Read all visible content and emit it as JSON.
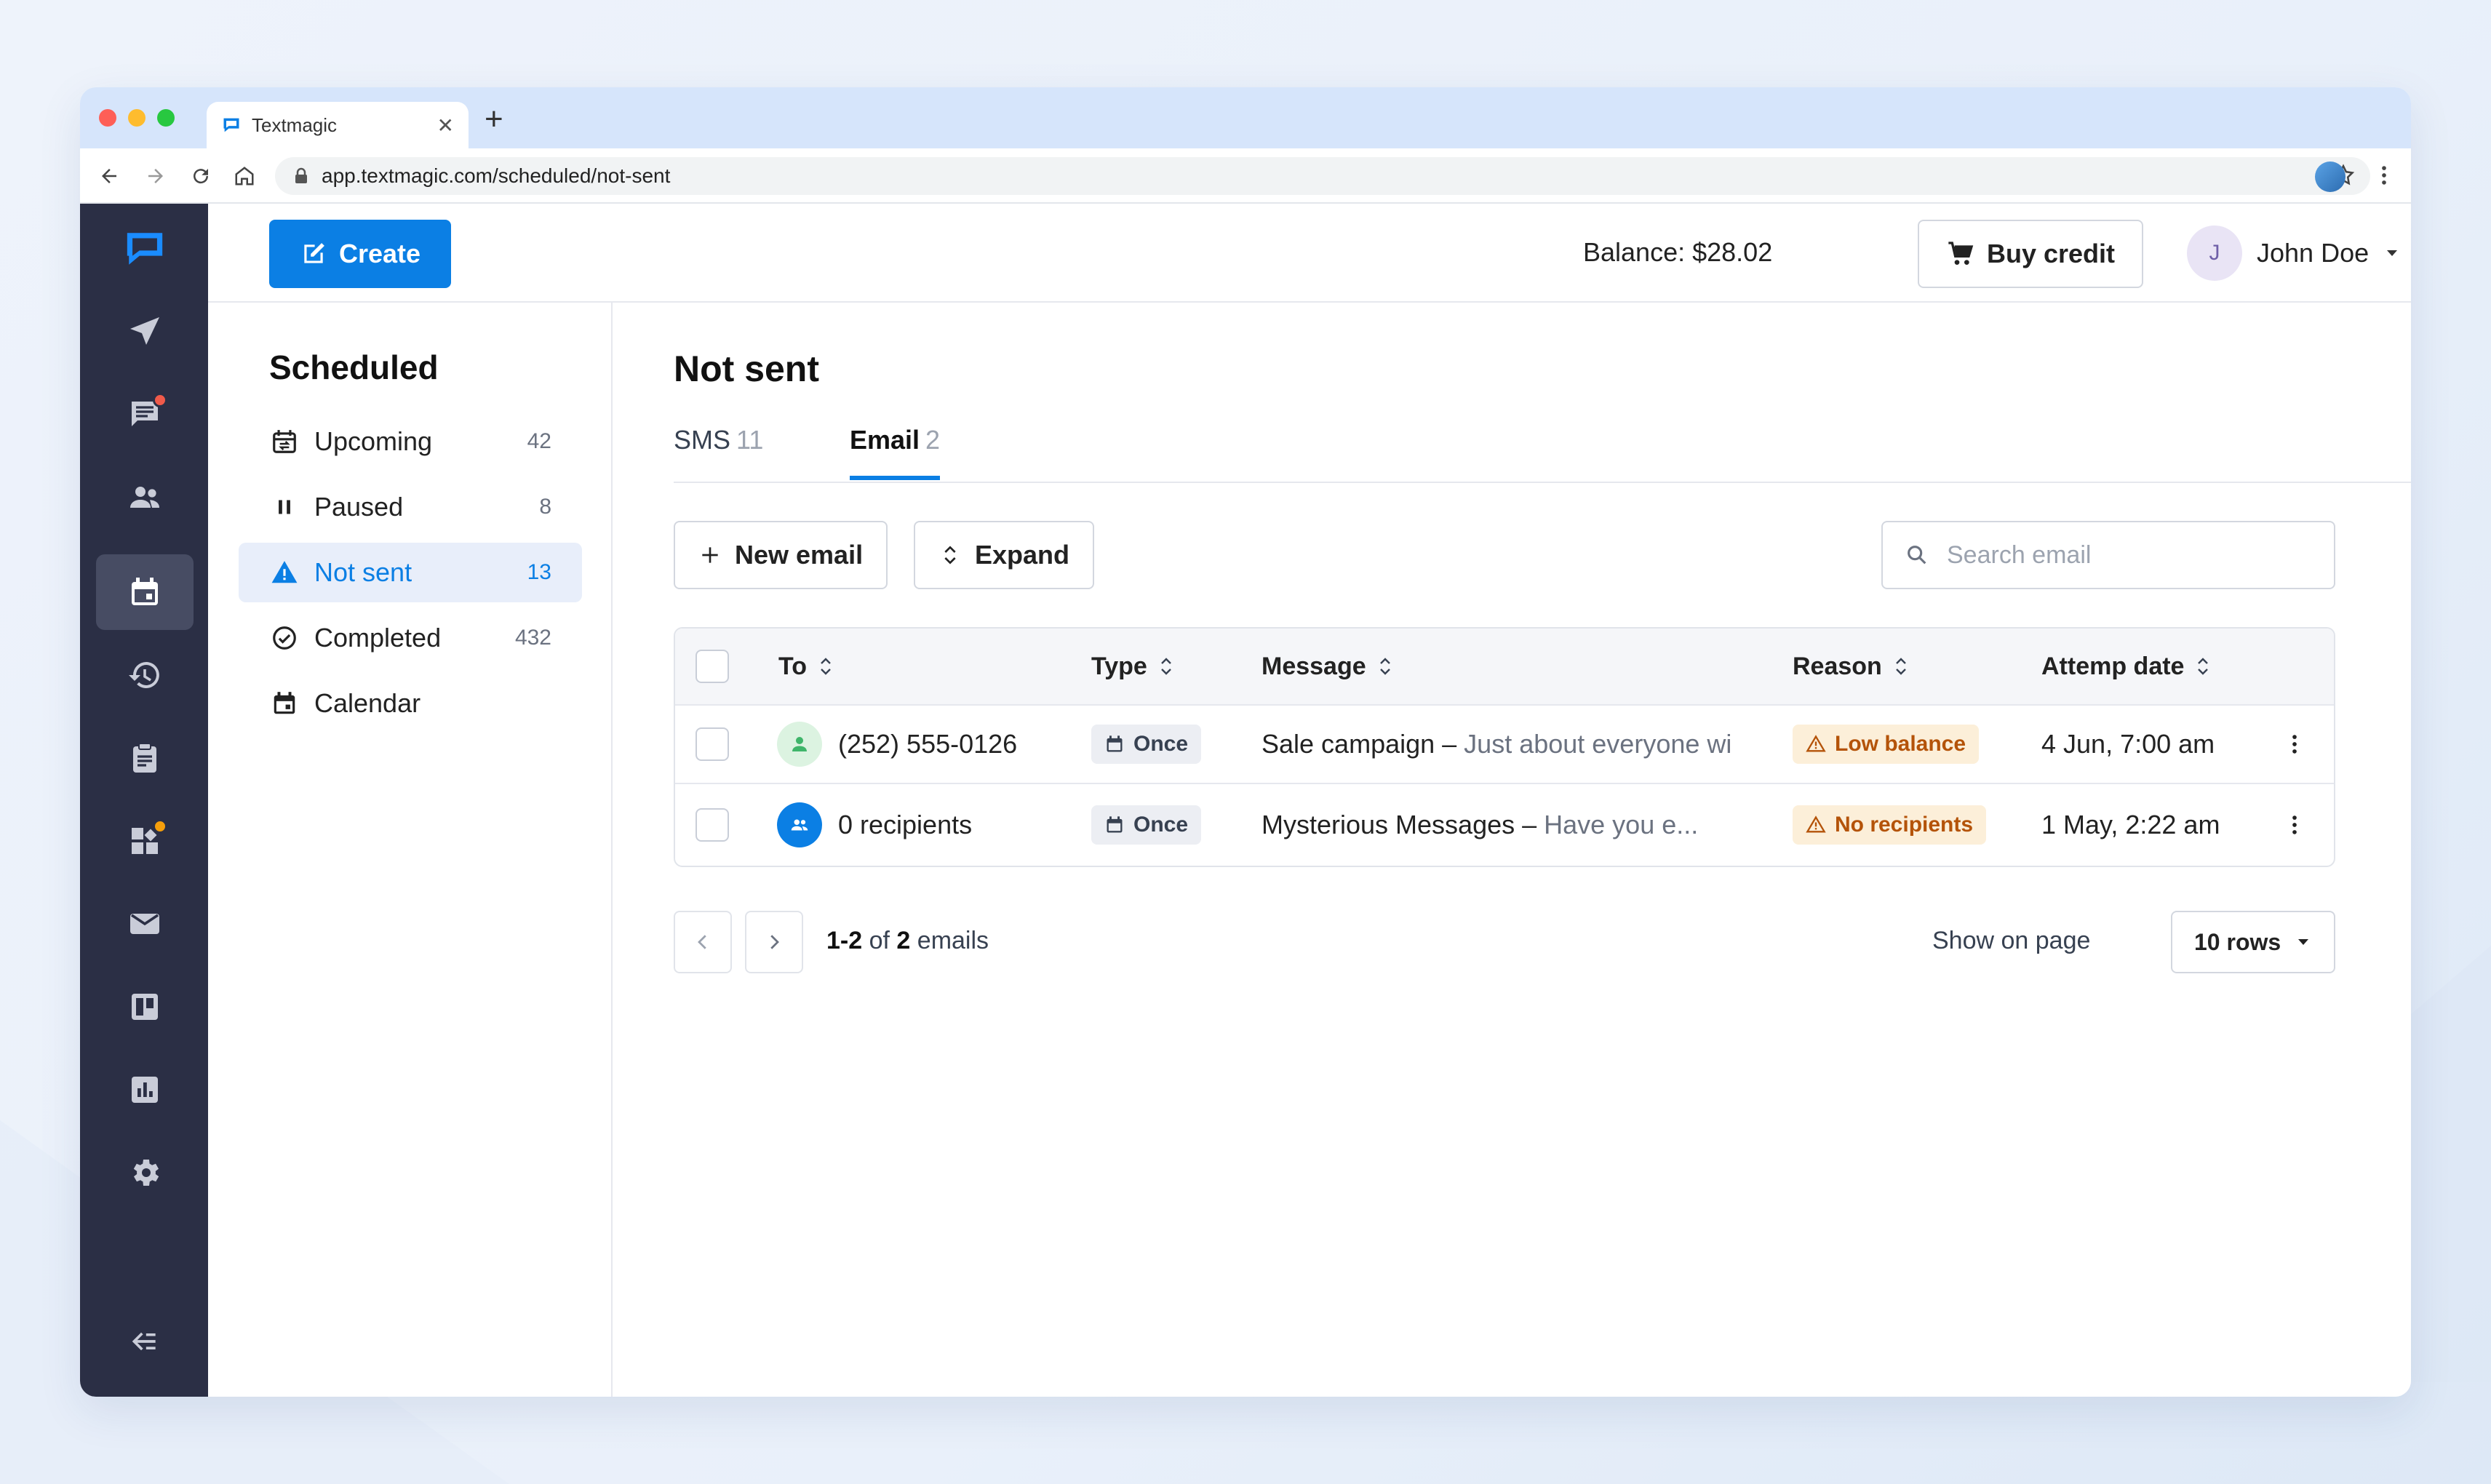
{
  "browser": {
    "tab_title": "Textmagic",
    "url": "app.textmagic.com/scheduled/not-sent"
  },
  "header": {
    "create_label": "Create",
    "balance": "Balance: $28.02",
    "buy_credit_label": "Buy credit",
    "user_initial": "J",
    "user_name": "John Doe"
  },
  "rail": {
    "items": [
      "logo",
      "send-icon",
      "chat-icon",
      "contacts-icon",
      "calendar-icon",
      "history-icon",
      "clipboard-icon",
      "apps-icon",
      "email-icon",
      "board-icon",
      "reports-icon",
      "settings-icon",
      "collapse-icon"
    ],
    "active": "calendar-icon"
  },
  "subnav": {
    "title": "Scheduled",
    "items": [
      {
        "label": "Upcoming",
        "count": "42"
      },
      {
        "label": "Paused",
        "count": "8"
      },
      {
        "label": "Not sent",
        "count": "13"
      },
      {
        "label": "Completed",
        "count": "432"
      },
      {
        "label": "Calendar",
        "count": ""
      }
    ]
  },
  "main": {
    "title": "Not sent",
    "tabs": [
      {
        "label": "SMS",
        "count": "11"
      },
      {
        "label": "Email",
        "count": "2"
      }
    ],
    "new_email_label": "New email",
    "expand_label": "Expand",
    "search_placeholder": "Search email"
  },
  "table": {
    "headers": [
      "To",
      "Type",
      "Message",
      "Reason",
      "Attemp date"
    ],
    "rows": [
      {
        "to": "(252) 555-0126",
        "type": "Once",
        "msg_title": "Sale campaign –",
        "msg_sub": "Just about everyone wi",
        "reason": "Low balance",
        "date": "4 Jun, 7:00 am"
      },
      {
        "to": "0 recipients",
        "type": "Once",
        "msg_title": "Mysterious Messages –",
        "msg_sub": "Have you e...",
        "reason": "No recipients",
        "date": "1 May, 2:22 am"
      }
    ]
  },
  "pagination": {
    "range": "1-2",
    "of": "of",
    "total": "2",
    "unit": "emails",
    "show_label": "Show on page",
    "rows_value": "10 rows"
  },
  "colors": {
    "accent": "#0b7fe4",
    "rail_bg": "#2b2f45",
    "warning_bg": "#fcefd9",
    "warning_text": "#b45309"
  }
}
